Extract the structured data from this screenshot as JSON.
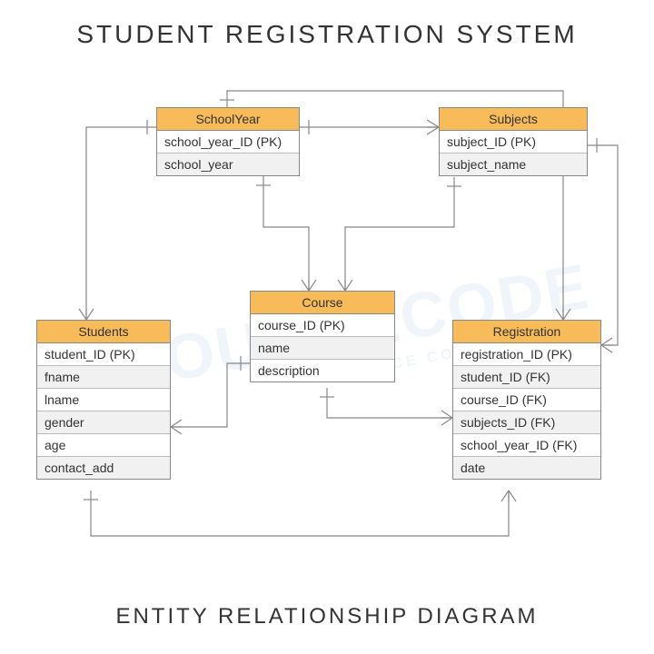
{
  "title": "STUDENT REGISTRATION SYSTEM",
  "subtitle": "ENTITY RELATIONSHIP DIAGRAM",
  "watermark": {
    "main": "ITSOURCECODE",
    "sub": "SOURCE CODE AND MORE"
  },
  "entities": {
    "schoolYear": {
      "name": "SchoolYear",
      "attrs": [
        "school_year_ID (PK)",
        "school_year"
      ]
    },
    "subjects": {
      "name": "Subjects",
      "attrs": [
        "subject_ID (PK)",
        "subject_name"
      ]
    },
    "students": {
      "name": "Students",
      "attrs": [
        "student_ID (PK)",
        "fname",
        "lname",
        "gender",
        "age",
        "contact_add"
      ]
    },
    "course": {
      "name": "Course",
      "attrs": [
        "course_ID (PK)",
        "name",
        "description"
      ]
    },
    "registration": {
      "name": "Registration",
      "attrs": [
        "registration_ID (PK)",
        "student_ID (FK)",
        "course_ID (FK)",
        "subjects_ID (FK)",
        "school_year_ID (FK)",
        "date"
      ]
    }
  },
  "relationships": [
    {
      "from": "SchoolYear",
      "to": "Subjects",
      "type": "one-to-many"
    },
    {
      "from": "SchoolYear",
      "to": "Students",
      "type": "one-to-many"
    },
    {
      "from": "SchoolYear",
      "to": "Course",
      "type": "one-to-many"
    },
    {
      "from": "SchoolYear",
      "to": "Registration",
      "type": "one-to-many (FK school_year_ID)"
    },
    {
      "from": "Subjects",
      "to": "Course",
      "type": "one-to-many"
    },
    {
      "from": "Subjects",
      "to": "Registration",
      "type": "one-to-many (FK subjects_ID)"
    },
    {
      "from": "Course",
      "to": "Students",
      "type": "one-to-many"
    },
    {
      "from": "Course",
      "to": "Registration",
      "type": "one-to-many (FK course_ID)"
    },
    {
      "from": "Students",
      "to": "Registration",
      "type": "one-to-many (FK student_ID)"
    }
  ]
}
